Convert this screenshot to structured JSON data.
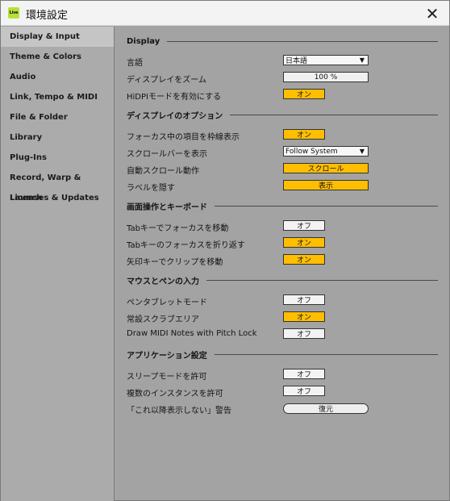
{
  "window": {
    "title": "環境設定",
    "app_icon_label": "Live",
    "close_glyph": "✕"
  },
  "sidebar": {
    "items": [
      {
        "label": "Display & Input",
        "selected": true
      },
      {
        "label": "Theme & Colors"
      },
      {
        "label": "Audio"
      },
      {
        "label": "Link, Tempo & MIDI"
      },
      {
        "label": "File & Folder"
      },
      {
        "label": "Library"
      },
      {
        "label": "Plug-Ins"
      },
      {
        "label": "Record, Warp & Launch"
      },
      {
        "label": "Licenses & Updates"
      }
    ]
  },
  "sections": {
    "display": {
      "title": "Display",
      "language_label": "言語",
      "language_value": "日本語",
      "zoom_label": "ディスプレイをズーム",
      "zoom_value": "100 %",
      "hidpi_label": "HiDPIモードを有効にする",
      "hidpi_value": "オン"
    },
    "display_options": {
      "title": "ディスプレイのオプション",
      "focus_frame_label": "フォーカス中の項目を枠線表示",
      "focus_frame_value": "オン",
      "scrollbar_label": "スクロールバーを表示",
      "scrollbar_value": "Follow System",
      "auto_scroll_label": "自動スクロール動作",
      "auto_scroll_value": "スクロール",
      "hide_labels_label": "ラベルを隠す",
      "hide_labels_value": "表示"
    },
    "navigation": {
      "title": "画面操作とキーボード",
      "tab_focus_label": "Tabキーでフォーカスを移動",
      "tab_focus_value": "オフ",
      "tab_wrap_label": "Tabキーのフォーカスを折り返す",
      "tab_wrap_value": "オン",
      "arrow_clip_label": "矢印キーでクリップを移動",
      "arrow_clip_value": "オン"
    },
    "mouse_pen": {
      "title": "マウスとペンの入力",
      "pen_tablet_label": "ペンタブレットモード",
      "pen_tablet_value": "オフ",
      "scrub_area_label": "常設スクラブエリア",
      "scrub_area_value": "オン",
      "midi_pitch_lock_label": "Draw MIDI Notes with Pitch Lock",
      "midi_pitch_lock_value": "オフ"
    },
    "app_settings": {
      "title": "アプリケーション設定",
      "sleep_label": "スリープモードを許可",
      "sleep_value": "オフ",
      "multi_instance_label": "複数のインスタンスを許可",
      "multi_instance_value": "オフ",
      "dont_show_label": "「これ以降表示しない」警告",
      "dont_show_value": "復元"
    }
  },
  "colors": {
    "accent_on": "#ffbe00",
    "background": "#a3a3a3",
    "sidebar_selected": "#c5c5c5"
  }
}
